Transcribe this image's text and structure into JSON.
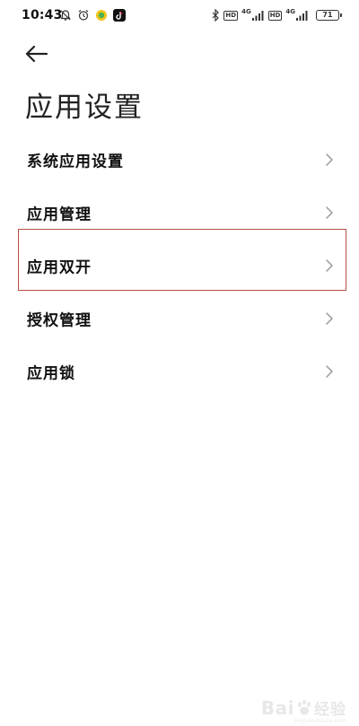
{
  "status_bar": {
    "time": "10:43",
    "left_icons": [
      "mute-bell-icon",
      "alarm-clock-icon",
      "app-notification-icon",
      "tiktok-icon"
    ],
    "hd_label_1": "HD",
    "net_label_1": "4G",
    "hd_label_2": "HD",
    "net_label_2": "4G",
    "battery_level": "71"
  },
  "header": {
    "back_icon": "back-arrow-icon",
    "title": "应用设置"
  },
  "settings_list": {
    "items": [
      {
        "label": "系统应用设置",
        "icon": "chevron-right-icon"
      },
      {
        "label": "应用管理",
        "icon": "chevron-right-icon"
      },
      {
        "label": "应用双开",
        "icon": "chevron-right-icon",
        "highlighted": true
      },
      {
        "label": "授权管理",
        "icon": "chevron-right-icon"
      },
      {
        "label": "应用锁",
        "icon": "chevron-right-icon"
      }
    ]
  },
  "highlight": {
    "color": "#b8503f"
  },
  "watermark": {
    "brand": "Bai",
    "brand_cn": "经验",
    "sub": "jingyan.baidu.com"
  },
  "colors": {
    "background": "#ffffff",
    "text": "#111111",
    "chevron": "#9a9a9a"
  }
}
